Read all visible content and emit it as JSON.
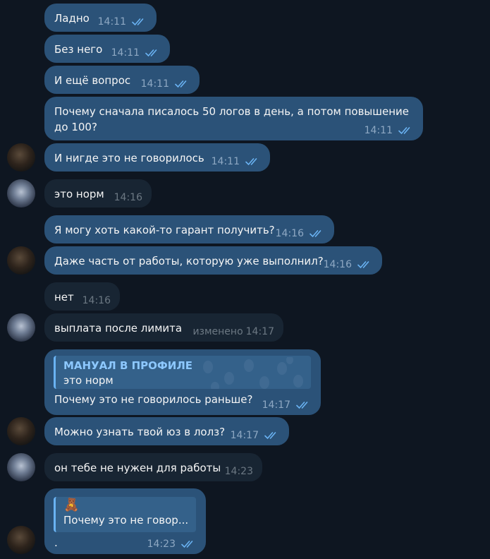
{
  "messages": [
    {
      "text": "Ладно",
      "time": "14:11"
    },
    {
      "text": "Без него",
      "time": "14:11"
    },
    {
      "text": "И ещё вопрос",
      "time": "14:11"
    },
    {
      "text": "Почему сначала писалось 50 логов в день, а потом повышение до 100?",
      "time": "14:11"
    },
    {
      "text": "И нигде это не говорилось",
      "time": "14:11"
    },
    {
      "text": "это норм",
      "time": "14:16"
    },
    {
      "text": "Я могу хоть какой-то гарант получить?",
      "time": "14:16"
    },
    {
      "text": "Даже часть от работы, которую уже выполнил?",
      "time": "14:16"
    },
    {
      "text": "нет",
      "time": "14:16"
    },
    {
      "text": "выплата после лимита",
      "time": "14:17",
      "edited": "изменено"
    },
    {
      "text": "Почему это не говорилось раньше?",
      "time": "14:17",
      "quote_title": "МАНУАЛ В ПРОФИЛЕ",
      "quote_text": "это норм"
    },
    {
      "text": "Можно узнать твой юз в лолз?",
      "time": "14:17"
    },
    {
      "text": "он тебе не нужен для работы",
      "time": "14:23"
    },
    {
      "text": ".",
      "time": "14:23",
      "quote_sticker": "🧸",
      "quote_text": "Почему это не говор..."
    }
  ],
  "colors": {
    "background": "#0e1621",
    "outgoing_bubble": "#2b5278",
    "incoming_bubble": "#182533",
    "accent": "#6ab3f3"
  },
  "icons": {
    "read_status": "double-check-icon",
    "sticker": "teddy-bear-icon"
  }
}
